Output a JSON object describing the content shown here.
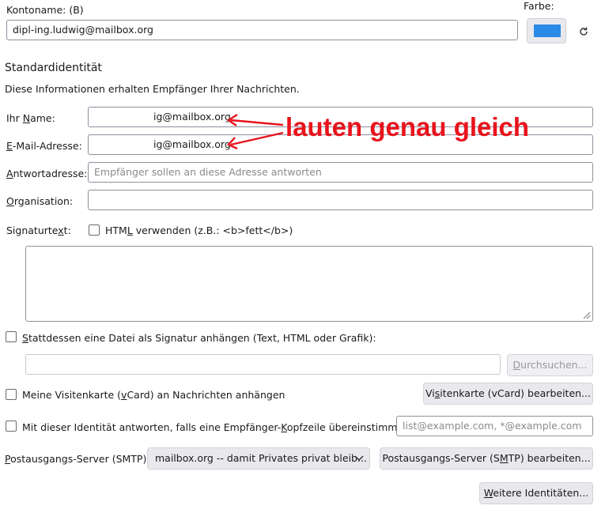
{
  "account": {
    "name_label": "Kontoname: (B)",
    "name_value": "dipl-ing.ludwig@mailbox.org",
    "color_label": "Farbe:",
    "color_value": "#2b8ae6",
    "reset_icon": "reset-icon"
  },
  "identity": {
    "section_title": "Standardidentität",
    "section_desc": "Diese Informationen erhalten Empfänger Ihrer Nachrichten.",
    "name": {
      "prefix": "Ihr ",
      "key": "N",
      "suffix": "ame:",
      "value": "ig@mailbox.org"
    },
    "email": {
      "key": "E",
      "suffix": "-Mail-Adresse:",
      "value": "ig@mailbox.org"
    },
    "reply": {
      "key": "A",
      "suffix": "ntwortadresse:",
      "placeholder": "Empfänger sollen an diese Adresse antworten"
    },
    "org": {
      "key": "O",
      "suffix": "rganisation:",
      "value": ""
    },
    "signature": {
      "label_prefix": "Signaturte",
      "label_key": "x",
      "label_suffix": "t:",
      "html_checkbox_prefix": "HTM",
      "html_checkbox_key": "L",
      "html_checkbox_suffix": " verwenden (z.B.: <b>fett</b>)",
      "html_checked": false,
      "text": ""
    },
    "attach_file": {
      "key": "S",
      "label": "tattdessen eine Datei als Signatur anhängen (Text, HTML oder Grafik):",
      "checked": false
    },
    "file_path": "",
    "browse_button": {
      "key": "D",
      "label": "urchsuchen..."
    },
    "vcard": {
      "prefix": "Meine Visitenkarte (",
      "key": "v",
      "suffix": "Card) an Nachrichten anhängen",
      "checked": false
    },
    "vcard_button": {
      "prefix": "Vi",
      "key": "s",
      "suffix": "itenkarte (vCard) bearbeiten..."
    },
    "reply_match": {
      "prefix": "Mit dieser Identität antworten, falls eine Empfänger-",
      "key": "K",
      "suffix": "opfzeile übereinstimmt mit:",
      "checked": false,
      "placeholder": "list@example.com, *@example.com"
    },
    "smtp": {
      "key": "P",
      "label": "ostausgangs-Server (SMTP):",
      "selected": "mailbox.org -- damit Privates privat bleib...",
      "chevron_icon": "chevron-down-icon"
    },
    "smtp_button": {
      "prefix": "Postausgangs-Server (S",
      "key": "M",
      "suffix": "TP) bearbeiten..."
    },
    "more_identities_button": {
      "key": "W",
      "label": "eitere Identitäten..."
    }
  },
  "annotation": {
    "text": "lauten genau gleich",
    "color": "#e8131c"
  }
}
